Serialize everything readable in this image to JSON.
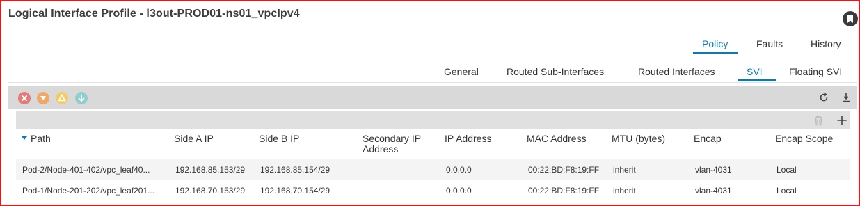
{
  "page": {
    "title": "Logical Interface Profile - l3out-PROD01-ns01_vpcIpv4"
  },
  "top_tabs": [
    {
      "label": "Policy",
      "active": true
    },
    {
      "label": "Faults",
      "active": false
    },
    {
      "label": "History",
      "active": false
    }
  ],
  "sub_tabs": [
    {
      "label": "General",
      "active": false
    },
    {
      "label": "Routed Sub-Interfaces",
      "active": false
    },
    {
      "label": "Routed Interfaces",
      "active": false
    },
    {
      "label": "SVI",
      "active": true
    },
    {
      "label": "Floating SVI",
      "active": false
    }
  ],
  "toolbar": {
    "fault_icons": [
      "critical-fault-icon",
      "major-fault-icon",
      "minor-fault-icon",
      "warning-fault-icon"
    ],
    "fault_colors": [
      "#e47b7b",
      "#f0a868",
      "#f2cc6a",
      "#8fd0cc"
    ],
    "actions": [
      "refresh-icon",
      "download-icon"
    ]
  },
  "table": {
    "actions": [
      "trash-icon",
      "plus-icon"
    ],
    "columns": [
      {
        "label": "Path",
        "sorted": "desc"
      },
      {
        "label": "Side A IP"
      },
      {
        "label": "Side B IP"
      },
      {
        "label": "Secondary IP\nAddress"
      },
      {
        "label": "IP Address"
      },
      {
        "label": "MAC Address"
      },
      {
        "label": "MTU (bytes)"
      },
      {
        "label": "Encap"
      },
      {
        "label": "Encap Scope"
      }
    ],
    "rows": [
      {
        "path": "Pod-2/Node-401-402/vpc_leaf40...",
        "side_a_ip": "192.168.85.153/29",
        "side_b_ip": "192.168.85.154/29",
        "secondary_ip": "",
        "ip_address": "0.0.0.0",
        "mac_address": "00:22:BD:F8:19:FF",
        "mtu": "inherit",
        "encap": "vlan-4031",
        "encap_scope": "Local"
      },
      {
        "path": "Pod-1/Node-201-202/vpc_leaf201...",
        "side_a_ip": "192.168.70.153/29",
        "side_b_ip": "192.168.70.154/29",
        "secondary_ip": "",
        "ip_address": "0.0.0.0",
        "mac_address": "00:22:BD:F8:19:FF",
        "mtu": "inherit",
        "encap": "vlan-4031",
        "encap_scope": "Local"
      }
    ]
  },
  "colors": {
    "accent": "#0a7aaf",
    "frame": "#e01b1b",
    "toolbar_bg": "#d9d9d9"
  }
}
